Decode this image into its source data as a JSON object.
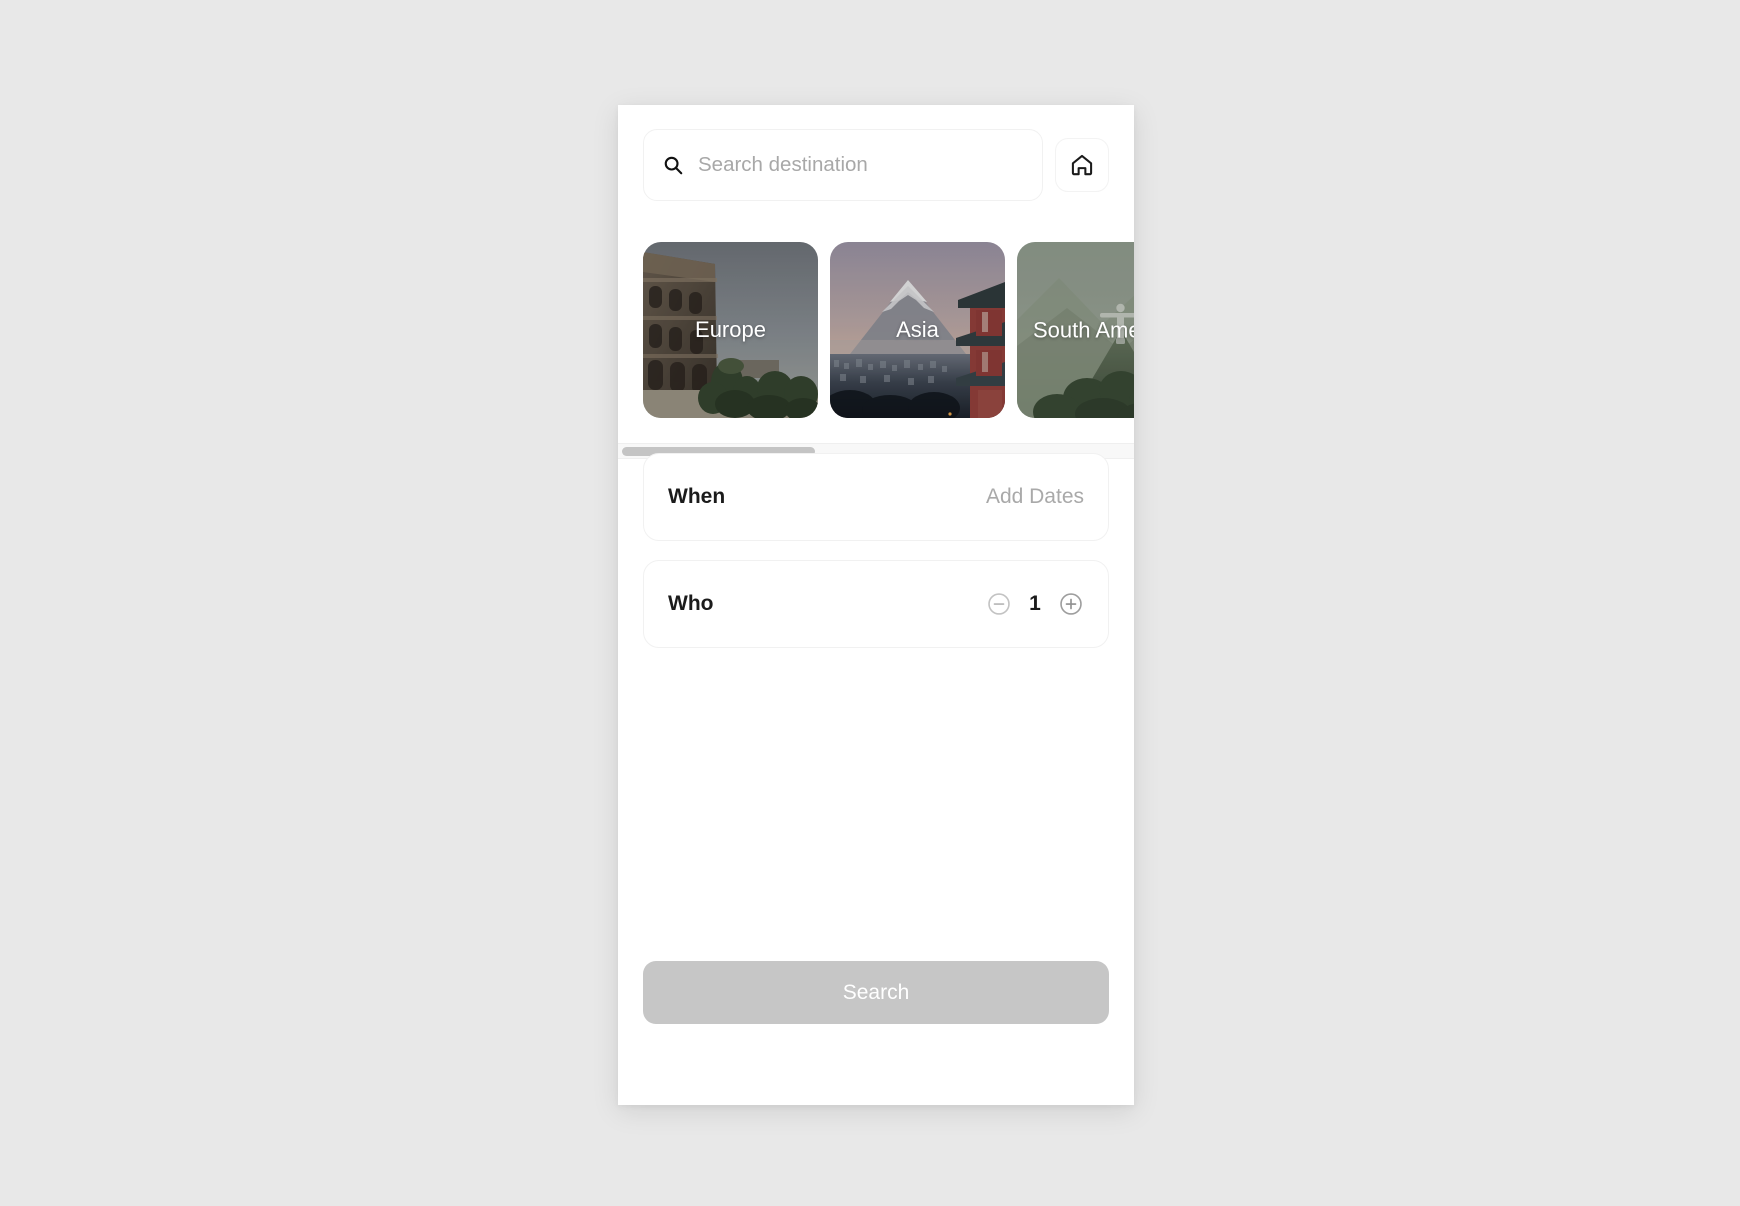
{
  "search": {
    "placeholder": "Search destination",
    "value": "",
    "icon": "search-icon",
    "home_icon": "home-icon"
  },
  "destinations": {
    "items": [
      {
        "label": "Europe",
        "image": "colosseum-rome-photo"
      },
      {
        "label": "Asia",
        "image": "mount-fuji-pagoda-photo"
      },
      {
        "label": "South America",
        "image": "christ-the-redeemer-photo"
      }
    ],
    "scroll_thumb_percent": 38
  },
  "fields": {
    "when": {
      "label": "When",
      "value": "Add Dates"
    },
    "who": {
      "label": "Who",
      "count": "1",
      "decrement_icon": "minus-circle-icon",
      "increment_icon": "plus-circle-icon"
    }
  },
  "cta": {
    "search_label": "Search"
  },
  "colors": {
    "page_background": "#e8e8e8",
    "panel_background": "#ffffff",
    "text_primary": "#1b1b1b",
    "text_muted": "#a9a9a9",
    "cta_disabled": "#c6c6c6",
    "scrollbar_thumb": "#c4c4c4"
  }
}
